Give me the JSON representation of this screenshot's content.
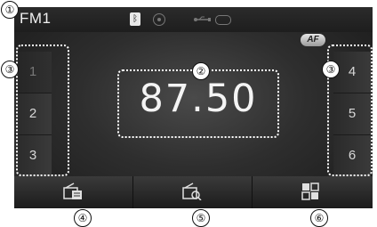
{
  "header": {
    "mode_label": "FM1",
    "af_badge": "AF"
  },
  "status_icons": [
    "bluetooth-icon",
    "disc-icon",
    "usb-icon",
    "battery-icon"
  ],
  "frequency": "87.50",
  "presets_left": [
    "1",
    "2",
    "3"
  ],
  "presets_right": [
    "4",
    "5",
    "6"
  ],
  "bottom_buttons": [
    "radio-list-icon",
    "radio-search-icon",
    "menu-grid-icon"
  ],
  "callouts": [
    "①",
    "②",
    "③",
    "③",
    "④",
    "⑤",
    "⑥"
  ],
  "colors": {
    "background": "#2e2e2e",
    "text": "#f4f4f4",
    "highlight_border": "#ffffff"
  }
}
